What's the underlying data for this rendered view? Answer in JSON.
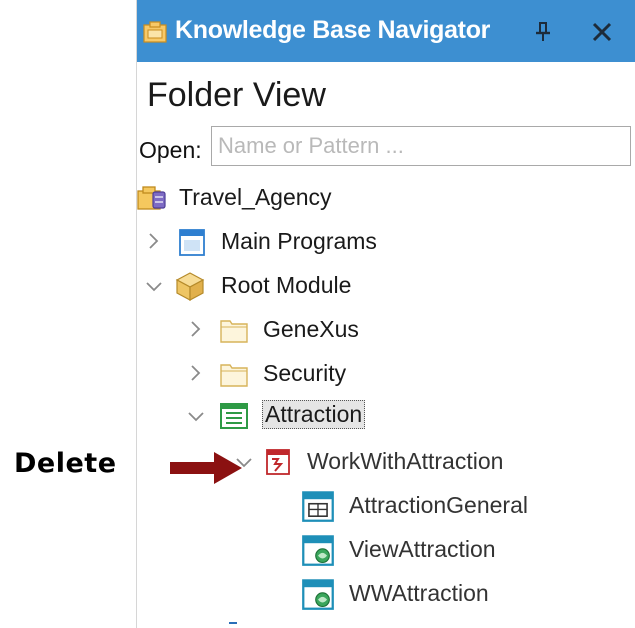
{
  "panel": {
    "title": "Knowledge Base Navigator",
    "heading": "Folder View",
    "open_label": "Open:",
    "open_placeholder": "Name or Pattern ..."
  },
  "tree": {
    "root": "Travel_Agency",
    "main_programs": "Main Programs",
    "root_module": "Root Module",
    "genexus": "GeneXus",
    "security": "Security",
    "attraction": "Attraction",
    "work_with": "WorkWithAttraction",
    "attraction_general": "AttractionGeneral",
    "view_attraction": "ViewAttraction",
    "ww_attraction": "WWAttraction"
  },
  "annotation": {
    "delete_label": "Delete"
  },
  "colors": {
    "titlebar": "#3d8fd1",
    "arrow": "#8b1111"
  }
}
